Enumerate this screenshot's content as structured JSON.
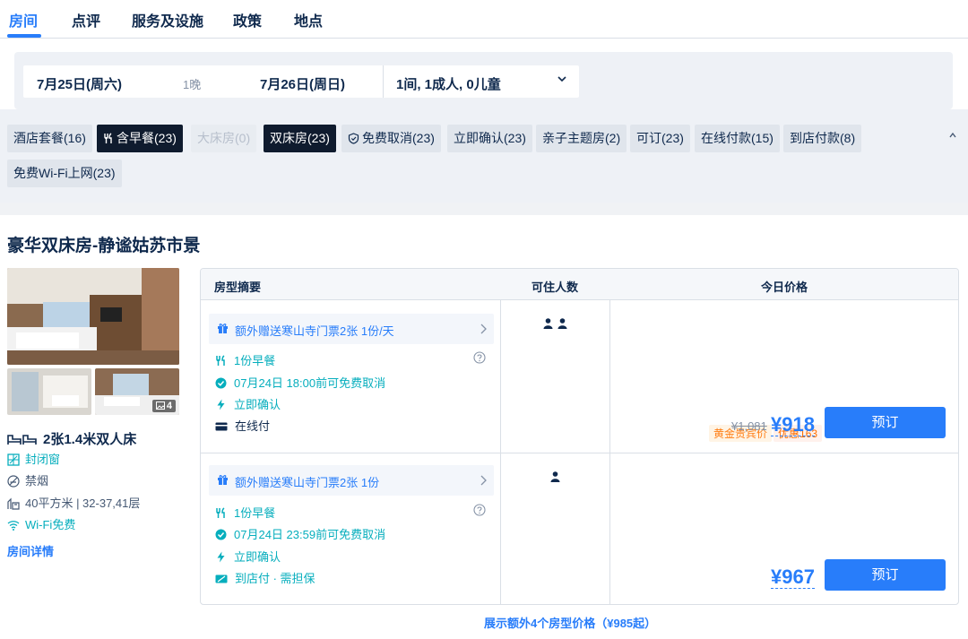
{
  "tabs": [
    {
      "label": "房间"
    },
    {
      "label": "点评"
    },
    {
      "label": "服务及设施"
    },
    {
      "label": "政策"
    },
    {
      "label": "地点"
    }
  ],
  "search": {
    "checkin": "7月25日(周六)",
    "nights": "1晚",
    "checkout": "7月26日(周日)",
    "guests": "1间, 1成人, 0儿童"
  },
  "filters": [
    {
      "label": "酒店套餐(16)",
      "state": "normal"
    },
    {
      "label": "含早餐(23)",
      "state": "selected",
      "icon": "utensils-icon"
    },
    {
      "label": "大床房(0)",
      "state": "disabled"
    },
    {
      "label": "双床房(23)",
      "state": "selected"
    },
    {
      "label": "免费取消(23)",
      "state": "normal",
      "icon": "shield-icon"
    },
    {
      "label": "立即确认(23)",
      "state": "normal"
    },
    {
      "label": "亲子主题房(2)",
      "state": "normal"
    },
    {
      "label": "可订(23)",
      "state": "normal"
    },
    {
      "label": "在线付款(15)",
      "state": "normal"
    },
    {
      "label": "到店付款(8)",
      "state": "normal"
    },
    {
      "label": "免费Wi-Fi上网(23)",
      "state": "normal"
    }
  ],
  "room": {
    "title": "豪华双床房-静谧姑苏市景",
    "photo_count": "4",
    "bed": "2张1.4米双人床",
    "features": [
      {
        "label": "封闭窗",
        "icon": "window-icon",
        "highlight": true
      },
      {
        "label": "禁烟",
        "icon": "no-smoking-icon",
        "highlight": false
      },
      {
        "label": "40平方米 | 32-37,41层",
        "icon": "area-icon",
        "highlight": false
      },
      {
        "label": "Wi-Fi免费",
        "icon": "wifi-icon",
        "highlight": true
      }
    ],
    "detail_link": "房间详情"
  },
  "table": {
    "headers": [
      "房型摘要",
      "可住人数",
      "今日价格"
    ],
    "offers": [
      {
        "gift": "额外赠送寒山寺门票2张 1份/天",
        "breakfast": "1份早餐",
        "cancel": "07月24日 18:00前可免费取消",
        "confirm": "立即确认",
        "payment": "在线付",
        "occupancy": 2,
        "promo_tag": "黄金贵宾价",
        "promo_discount": "优惠163",
        "original_price": "¥1,081",
        "price": "¥918",
        "book_label": "预订"
      },
      {
        "gift": "额外赠送寒山寺门票2张 1份",
        "breakfast": "1份早餐",
        "cancel": "07月24日 23:59前可免费取消",
        "confirm": "立即确认",
        "payment": "到店付 · 需担保",
        "occupancy": 1,
        "price": "¥967",
        "book_label": "预订"
      }
    ]
  },
  "more_link": "展示额外4个房型价格（¥985起）",
  "colors": {
    "accent": "#287dfa",
    "green": "#06aebd",
    "text": "#0f294d",
    "chip_selected": "#0f1b2e",
    "promo_orange": "#ff7d13"
  }
}
